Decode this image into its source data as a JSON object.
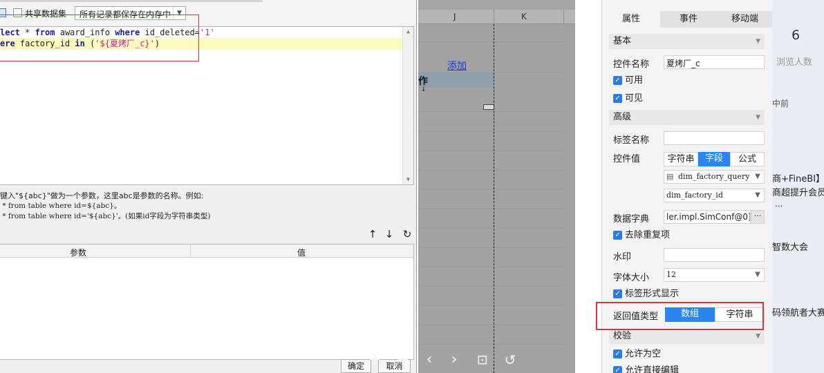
{
  "dialog": {
    "toolbar": {
      "shared_dataset_label": "共享数据集",
      "memory_select_value": "所有记录都保存在内存中"
    },
    "sql": {
      "line1": {
        "kw1": "lect",
        "p1": " * ",
        "kw2": "from",
        "p2": " award_info ",
        "kw3": "where",
        "p3": " id_deleted=",
        "s1": "'1'"
      },
      "line2": {
        "kw1": "ere",
        "p1": " factory_id ",
        "kw2": "in",
        "p2": " (",
        "s1": "'${夏烤厂_c}'",
        "p3": ")"
      }
    },
    "hint": {
      "line1": "键入\"${abc}\"做为一个参数，这里abc是参数的名称。例如:",
      "line2": " * from table where id=${abc}。",
      "line3": " * from table where id='${abc}'。(如果id字段为字符串类型)"
    },
    "param_table": {
      "col_param": "参数",
      "col_value": "值"
    },
    "buttons": {
      "ok": "确定",
      "cancel": "取消"
    }
  },
  "sheet": {
    "col_j": "J",
    "col_k": "K",
    "add_link": "添加",
    "op_cell": "作"
  },
  "panel": {
    "tabs": {
      "attr": "属性",
      "event": "事件",
      "mobile": "移动端"
    },
    "sections": {
      "basic": "基本",
      "advanced": "高级",
      "validate": "校验"
    },
    "control_name_label": "控件名称",
    "control_name_value": "夏烤厂_c",
    "enabled_label": "可用",
    "visible_label": "可见",
    "tag_name_label": "标签名称",
    "control_value_label": "控件值",
    "value_mode": {
      "string": "字符串",
      "field": "字段",
      "formula": "公式"
    },
    "dataset_select": "dim_factory_query",
    "field_select": "dim_factory_id",
    "dict_label": "数据字典",
    "dict_value": "ler.impl.SimConf@0]]",
    "dedupe_label": "去除重复项",
    "watermark_label": "水印",
    "font_size_label": "字体大小",
    "font_size_value": "12",
    "tag_display_label": "标签形式显示",
    "return_type_label": "返回值类型",
    "return_type": {
      "array": "数组",
      "string": "字符串"
    },
    "allow_empty_label": "允许为空",
    "allow_edit_label": "允许直接编辑"
  },
  "background_page": {
    "count": "6",
    "count_label": "浏览人数",
    "ago": "中前",
    "t1": "商+FineBI】",
    "t2": "商超提升会员",
    "t3": "...",
    "t4": "智数大会",
    "t5": "码领航者大赛"
  }
}
